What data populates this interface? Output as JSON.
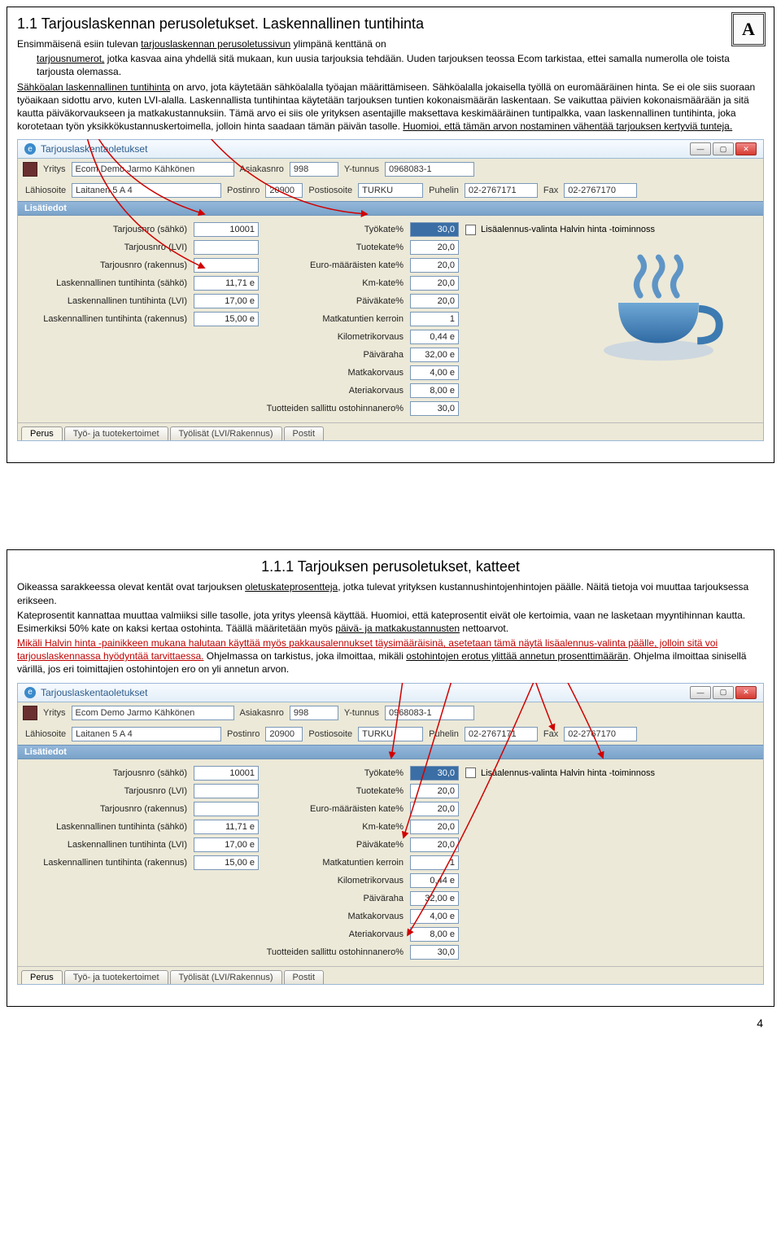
{
  "section1": {
    "title": "1.1 Tarjouslaskennan perusoletukset. Laskennallinen tuntihinta",
    "badge": "A",
    "p1a": "Ensimmäisenä esiin tulevan ",
    "p1b": "tarjouslaskennan perusoletussivun",
    "p1c": " ylimpänä kenttänä on ",
    "p1d": "tarjousnumerot,",
    "p1e": " jotka kasvaa aina yhdellä sitä mukaan, kun uusia tarjouksia tehdään. Uuden tarjouksen teossa Ecom tarkistaa, ettei samalla numerolla ole toista tarjousta olemassa.",
    "p2a": "Sähköalan laskennallinen tuntihinta",
    "p2b": " on arvo, jota käytetään sähköalalla työajan määrittämiseen. Sähköalalla jokaisella työllä on euromääräinen hinta. Se ei ole siis suoraan työaikaan sidottu arvo, kuten LVI-alalla. Laskennallista tuntihintaa käytetään tarjouksen tuntien kokonaismäärän laskentaan. Se vaikuttaa päivien kokonaismäärään ja sitä kautta päiväkorvaukseen ja matkakustannuksiin. Tämä arvo ei siis ole yrityksen asentajille maksettava keskimääräinen tuntipalkka, vaan laskennallinen tuntihinta, joka korotetaan työn yksikkökustannuskertoimella, jolloin hinta saadaan tämän päivän tasolle. ",
    "p2c": "Huomioi, että tämän arvon nostaminen vähentää tarjouksen kertyviä tunteja."
  },
  "section2": {
    "title": "1.1.1 Tarjouksen perusoletukset, katteet",
    "p1a": "Oikeassa sarakkeessa olevat kentät ovat tarjouksen ",
    "p1b": "oletuskateprosentteja",
    "p1c": ", jotka tulevat yrityksen kustannushintojenhintojen päälle. Näitä tietoja voi muuttaa tarjouksessa erikseen.",
    "p2": "Kateprosentit kannattaa muuttaa valmiiksi sille tasolle, jota yritys yleensä käyttää. Huomioi, että kateprosentit eivät ole kertoimia, vaan ne lasketaan myyntihinnan kautta. Esimerkiksi 50% kate on kaksi kertaa ostohinta. Täällä määritetään myös ",
    "p2u": "päivä- ja matkakustannusten",
    "p2e": " nettoarvot.",
    "p3": "Mikäli Halvin hinta -painikkeen mukana halutaan käyttää myös pakkausalennukset täysimääräisinä, asetetaan tämä näytä lisäalennus-valinta päälle, jolloin sitä voi tarjouslaskennassa hyödyntää tarvittaessa.",
    "p3b": " Ohjelmassa on tarkistus, joka ilmoittaa, mikäli ",
    "p3u": "ostohintojen erotus ylittää annetun prosenttimäärän",
    "p3c": ". Ohjelma ilmoittaa sinisellä värillä, jos eri toimittajien ostohintojen ero on yli annetun arvon."
  },
  "app": {
    "title": "Tarjouslaskentaoletukset",
    "header": {
      "yritys_label": "Yritys",
      "yritys": "Ecom Demo Jarmo Kähkönen",
      "asiakasnro_label": "Asiakasnro",
      "asiakasnro": "998",
      "ytunnus_label": "Y-tunnus",
      "ytunnus": "0968083-1",
      "lahiosoite_label": "Lähiosoite",
      "lahiosoite": "Laitanen 5 A 4",
      "postinro_label": "Postinro",
      "postinro": "20900",
      "postiosoite_label": "Postiosoite",
      "postiosoite": "TURKU",
      "puhelin_label": "Puhelin",
      "puhelin": "02-2767171",
      "fax_label": "Fax",
      "fax": "02-2767170"
    },
    "lisatiedot": "Lisätiedot",
    "left_labels": [
      "Tarjousnro (sähkö)",
      "Tarjousnro (LVI)",
      "Tarjousnro (rakennus)",
      "Laskennallinen tuntihinta (sähkö)",
      "Laskennallinen tuntihinta (LVI)",
      "Laskennallinen tuntihinta (rakennus)"
    ],
    "left_values": [
      "10001",
      "",
      "",
      "11,71 e",
      "17,00 e",
      "15,00 e"
    ],
    "right_labels": [
      "Työkate%",
      "Tuotekate%",
      "Euro-määräisten kate%",
      "Km-kate%",
      "Päiväkate%",
      "Matkatuntien kerroin",
      "Kilometrikorvaus",
      "Päiväraha",
      "Matkakorvaus",
      "Ateriakorvaus",
      "Tuotteiden sallittu ostohinnanero%"
    ],
    "right_values": [
      "30,0",
      "20,0",
      "20,0",
      "20,0",
      "20,0",
      "1",
      "0,44 e",
      "32,00 e",
      "4,00 e",
      "8,00 e",
      "30,0"
    ],
    "checkbox_label": "Lisäalennus-valinta Halvin hinta -toiminnoss",
    "tabs": [
      "Perus",
      "Työ- ja tuotekertoimet",
      "Työlisät (LVI/Rakennus)",
      "Postit"
    ]
  },
  "page_num": "4"
}
